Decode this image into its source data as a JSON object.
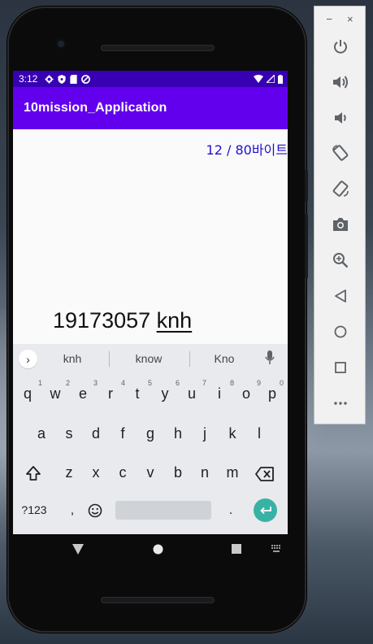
{
  "status_bar": {
    "time": "3:12"
  },
  "app_bar": {
    "title": "10mission_Application"
  },
  "content": {
    "byte_counter": "12 / 80바이트",
    "input_committed": "19173057 ",
    "input_composing": "knh"
  },
  "keyboard": {
    "suggestions": [
      "knh",
      "know",
      "Kno"
    ],
    "row1": [
      {
        "key": "q",
        "hint": "1"
      },
      {
        "key": "w",
        "hint": "2"
      },
      {
        "key": "e",
        "hint": "3"
      },
      {
        "key": "r",
        "hint": "4"
      },
      {
        "key": "t",
        "hint": "5"
      },
      {
        "key": "y",
        "hint": "6"
      },
      {
        "key": "u",
        "hint": "7"
      },
      {
        "key": "i",
        "hint": "8"
      },
      {
        "key": "o",
        "hint": "9"
      },
      {
        "key": "p",
        "hint": "0"
      }
    ],
    "row2": [
      "a",
      "s",
      "d",
      "f",
      "g",
      "h",
      "j",
      "k",
      "l"
    ],
    "row3": [
      "z",
      "x",
      "c",
      "v",
      "b",
      "n",
      "m"
    ],
    "symbols_label": "?123",
    "comma_label": ",",
    "period_label": "."
  },
  "colors": {
    "status_bar": "#3700b3",
    "app_bar": "#6200ee",
    "byte_counter": "#2211cc",
    "enter_key": "#38b2a4"
  },
  "emulator_panel": {
    "window_controls": [
      "−",
      "×"
    ],
    "buttons": [
      "power-icon",
      "volume-up-icon",
      "volume-down-icon",
      "rotate-left-icon",
      "rotate-right-icon",
      "camera-icon",
      "zoom-icon",
      "back-icon",
      "home-icon",
      "overview-icon",
      "more-icon"
    ]
  }
}
